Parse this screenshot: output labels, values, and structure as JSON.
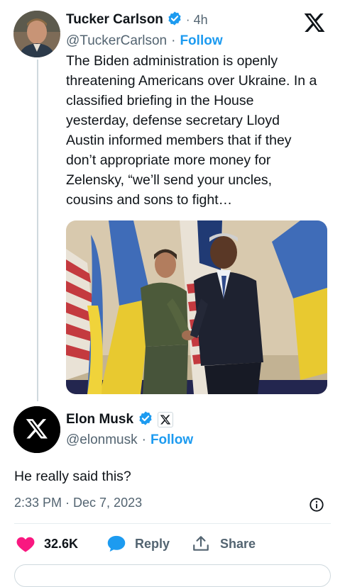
{
  "original_tweet": {
    "author_name": "Tucker Carlson",
    "time_ago": "4h",
    "handle": "@TuckerCarlson",
    "separator": "·",
    "follow_label": "Follow",
    "text": "The Biden administration is openly threatening Americans over Ukraine. In a classified briefing in the House yesterday, defense secretary Lloyd Austin informed members that if they don’t appropriate more money for Zelensky, “we’ll send your uncles, cousins and sons to fight…",
    "lines": [
      "The Biden administration is openly",
      "threatening Americans over Ukraine. In a",
      "classified briefing in the House",
      "yesterday, defense secretary Lloyd",
      "Austin informed members that if they",
      "don’t appropriate more money for",
      "Zelensky, “we’ll send your uncles,",
      "cousins and sons to fight…"
    ]
  },
  "reply_tweet": {
    "author_name": "Elon Musk",
    "handle": "@elonmusk",
    "separator": "·",
    "follow_label": "Follow",
    "text": "He really said this?",
    "timestamp": "2:33 PM · Dec 7, 2023"
  },
  "actions": {
    "likes": "32.6K",
    "reply_label": "Reply",
    "share_label": "Share"
  },
  "icons": {
    "brand": "x-logo-icon",
    "verified": "verified-badge-icon",
    "info": "info-icon",
    "like": "heart-icon",
    "reply": "speech-bubble-icon",
    "share": "share-upload-icon"
  },
  "colors": {
    "accent": "#1d9bf0",
    "like": "#f91880",
    "text": "#0f1419",
    "muted": "#536471"
  }
}
